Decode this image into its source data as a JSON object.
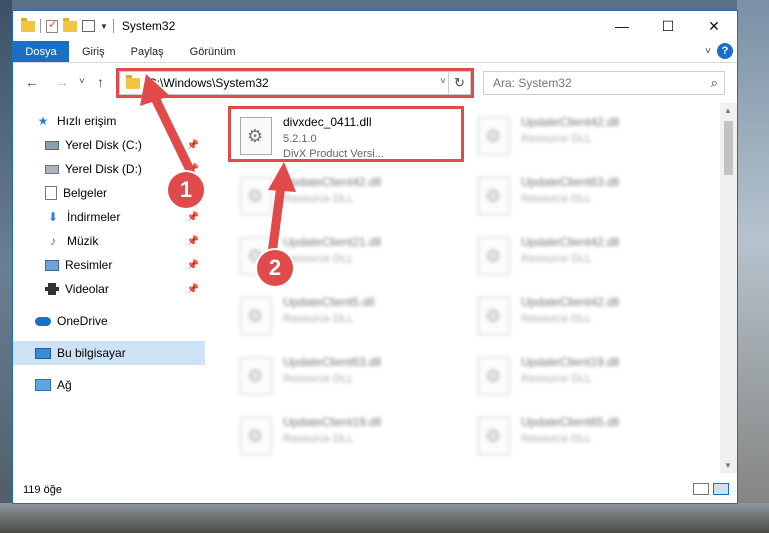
{
  "window": {
    "title": "System32",
    "controls": {
      "minimize": "—",
      "maximize": "☐",
      "close": "✕"
    }
  },
  "ribbon": {
    "tabs": [
      "Dosya",
      "Giriş",
      "Paylaş",
      "Görünüm"
    ],
    "help": "?"
  },
  "nav": {
    "back": "←",
    "forward": "→",
    "recent": "˅",
    "up": "↑",
    "address": "C:\\Windows\\System32",
    "refresh": "↻",
    "search_placeholder": "Ara: System32",
    "search_icon": "⌕"
  },
  "sidebar": {
    "items": [
      {
        "label": "Hızlı erişim",
        "icon": "star-icon"
      },
      {
        "label": "Yerel Disk (C:)",
        "icon": "drive-c-icon",
        "pinned": true
      },
      {
        "label": "Yerel Disk (D:)",
        "icon": "drive-d-icon",
        "pinned": true
      },
      {
        "label": "Belgeler",
        "icon": "documents-icon",
        "pinned": true
      },
      {
        "label": "İndirmeler",
        "icon": "download-icon",
        "pinned": true
      },
      {
        "label": "Müzik",
        "icon": "music-icon",
        "pinned": true
      },
      {
        "label": "Resimler",
        "icon": "pictures-icon",
        "pinned": true
      },
      {
        "label": "Videolar",
        "icon": "videos-icon",
        "pinned": true
      },
      {
        "label": "OneDrive",
        "icon": "cloud-icon"
      },
      {
        "label": "Bu bilgisayar",
        "icon": "computer-icon",
        "selected": true
      },
      {
        "label": "Ağ",
        "icon": "network-icon"
      }
    ],
    "pin_glyph": "📌"
  },
  "files": [
    {
      "name": "divxdec_0411.dll",
      "line1": "5.2.1.0",
      "line2": "DivX  Product Versi...",
      "highlight": true
    },
    {
      "name": "UpdateClient42.dll",
      "line1": "Resource DLL"
    },
    {
      "name": "UpdateClient42.dll",
      "line1": "Resource DLL"
    },
    {
      "name": "UpdateClient63.dll",
      "line1": "Resource DLL"
    },
    {
      "name": "UpdateClient21.dll",
      "line1": "Resource DLL"
    },
    {
      "name": "UpdateClient42.dll",
      "line1": "Resource DLL"
    },
    {
      "name": "UpdateClient5.dll",
      "line1": "Resource DLL"
    },
    {
      "name": "UpdateClient42.dll",
      "line1": "Resource DLL"
    },
    {
      "name": "UpdateClient63.dll",
      "line1": "Resource DLL"
    },
    {
      "name": "UpdateClient19.dll",
      "line1": "Resource DLL"
    },
    {
      "name": "UpdateClient19.dll",
      "line1": "Resource DLL"
    },
    {
      "name": "UpdateClient65.dll",
      "line1": "Resource DLL"
    }
  ],
  "status": {
    "count": "119 öğe"
  },
  "annotations": {
    "step1": "1",
    "step2": "2",
    "color": "#e04a4a"
  }
}
